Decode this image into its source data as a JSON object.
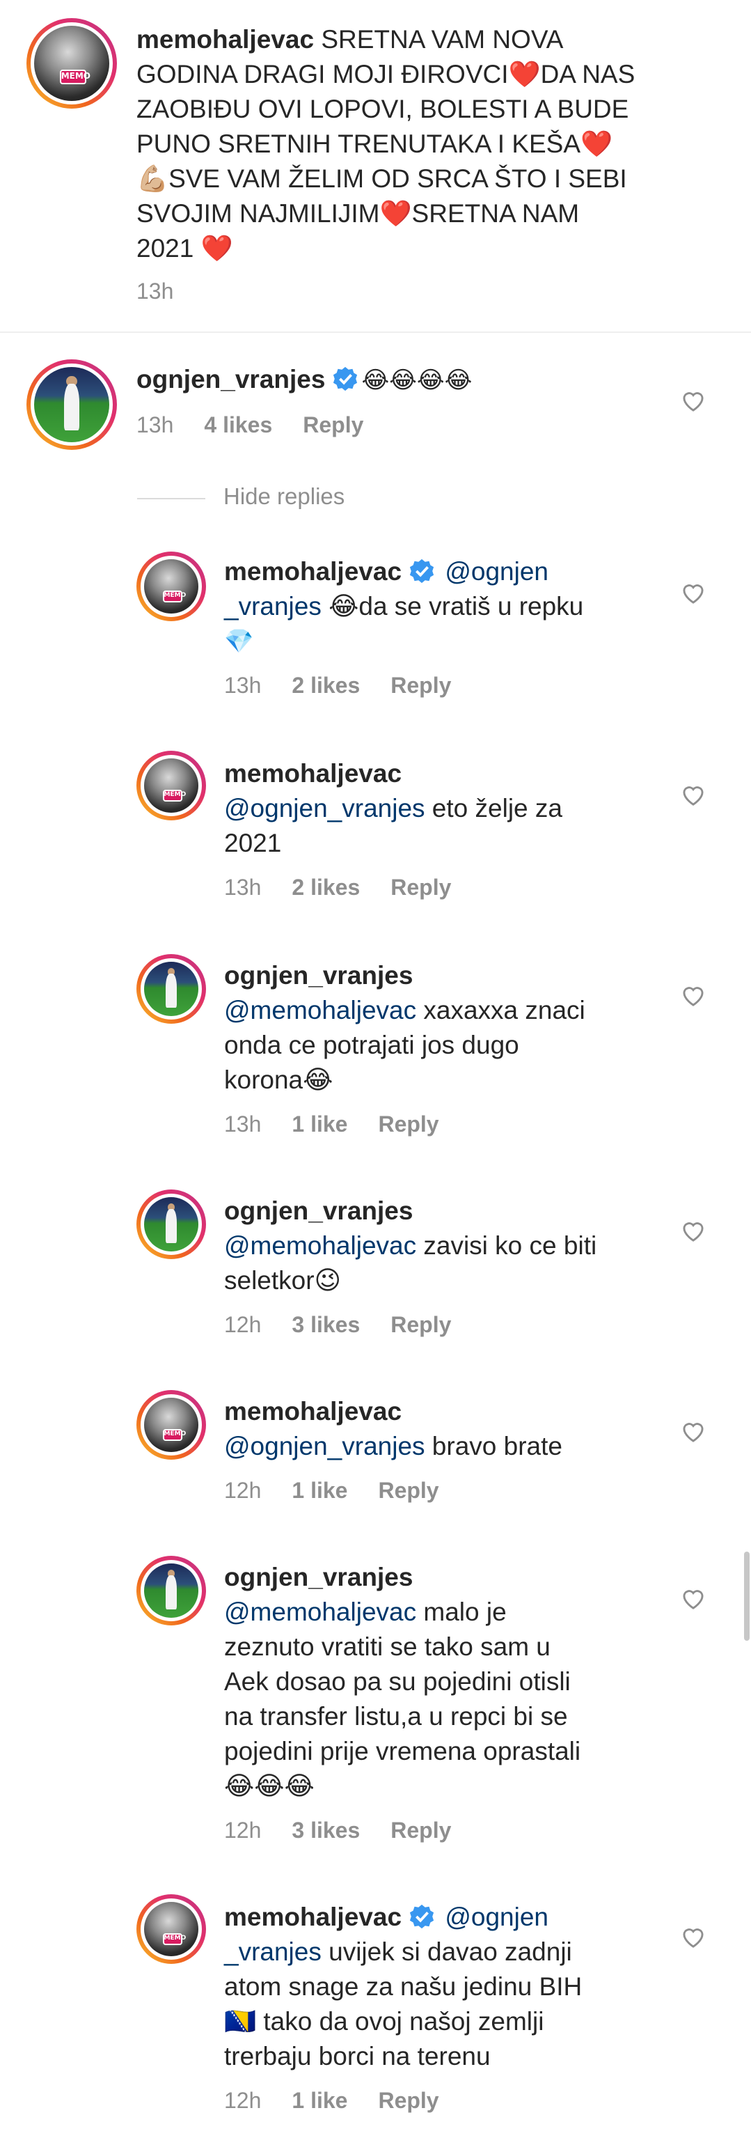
{
  "caption": {
    "username": "memohaljevac",
    "text": "SRETNA VAM NOVA GODINA DRAGI MOJI ĐIROVCI❤️DA NAS ZAOBIĐU OVI LOPOVI, BOLESTI A BUDE PUNO SRETNIH TRENUTAKA I KEŠA❤️💪🏼SVE VAM ŽELIM OD SRCA ŠTO I SEBI SVOJIM NAJMILIJIM❤️SRETNA NAM 2021 ❤️",
    "lines": [
      "SRETNA VAM NOVA",
      "GODINA DRAGI MOJI ĐIROVCI❤️DA NAS",
      "ZAOBIĐU OVI LOPOVI, BOLESTI A BUDE",
      "PUNO SRETNIH TRENUTAKA I KEŠA❤️",
      "💪🏼SVE VAM ŽELIM OD SRCA ŠTO I SEBI",
      "SVOJIM NAJMILIJIM❤️SRETNA NAM",
      "2021 ❤️"
    ],
    "time": "13h"
  },
  "parent_comment": {
    "username": "ognjen_vranjes",
    "verified": true,
    "text": "😂😂😂😂",
    "time": "13h",
    "likes": "4 likes",
    "reply": "Reply"
  },
  "hide_replies": "Hide replies",
  "replies": [
    {
      "username": "memohaljevac",
      "verified": true,
      "avatar": "memo",
      "lines": [
        [
          "@ognjen",
          "_vranjes 😂da se vratiš u repku"
        ],
        [
          "💎"
        ]
      ],
      "line1_rest": "@ognjen",
      "line2_mention": "_vranjes",
      "line2_text": " 😂da se vratiš u repku",
      "line3_text": "💎",
      "time": "13h",
      "likes": "2 likes",
      "reply": "Reply"
    },
    {
      "username": "memohaljevac",
      "verified": false,
      "avatar": "memo",
      "mention": "@ognjen_vranjes",
      "text1": " eto želje za",
      "text2": "2021",
      "time": "13h",
      "likes": "2 likes",
      "reply": "Reply"
    },
    {
      "username": "ognjen_vranjes",
      "verified": false,
      "avatar": "og",
      "mention": "@memohaljevac",
      "text1": " xaxaxxa znaci",
      "text2": "onda ce potrajati jos dugo",
      "text3": "korona😂",
      "time": "13h",
      "likes": "1 like",
      "reply": "Reply"
    },
    {
      "username": "ognjen_vranjes",
      "verified": false,
      "avatar": "og",
      "mention": "@memohaljevac",
      "text1": " zavisi ko ce biti",
      "text2": "seletkor😉",
      "time": "12h",
      "likes": "3 likes",
      "reply": "Reply"
    },
    {
      "username": "memohaljevac",
      "verified": false,
      "avatar": "memo",
      "mention": "@ognjen_vranjes",
      "text1": " bravo brate",
      "time": "12h",
      "likes": "1 like",
      "reply": "Reply"
    },
    {
      "username": "ognjen_vranjes",
      "verified": false,
      "avatar": "og",
      "mention": "@memohaljevac",
      "text1": " malo je",
      "text2": "zeznuto vratiti se tako sam u",
      "text3": "Aek dosao pa su pojedini otisli",
      "text4": "na transfer listu,a u repci bi se",
      "text5": "pojedini prije vremena oprastali",
      "text6": "😂😂😂",
      "time": "12h",
      "likes": "3 likes",
      "reply": "Reply"
    },
    {
      "username": "memohaljevac",
      "verified": true,
      "avatar": "memo",
      "mention1": "@ognjen",
      "mention2": "_vranjes",
      "text1": " uvijek si davao zadnji",
      "text2": "atom snage za našu jedinu BIH",
      "text3": "🇧🇦 tako da ovoj našoj zemlji",
      "text4": "trerbaju borci na terenu",
      "time": "12h",
      "likes": "1 like",
      "reply": "Reply"
    }
  ],
  "avatar_tag": "MEMO",
  "colors": {
    "link": "#00376b",
    "meta": "#8e8e8e",
    "verified": "#3897f0",
    "divider": "#efefef"
  },
  "icons": [
    "heart-icon",
    "verified-badge-icon"
  ]
}
